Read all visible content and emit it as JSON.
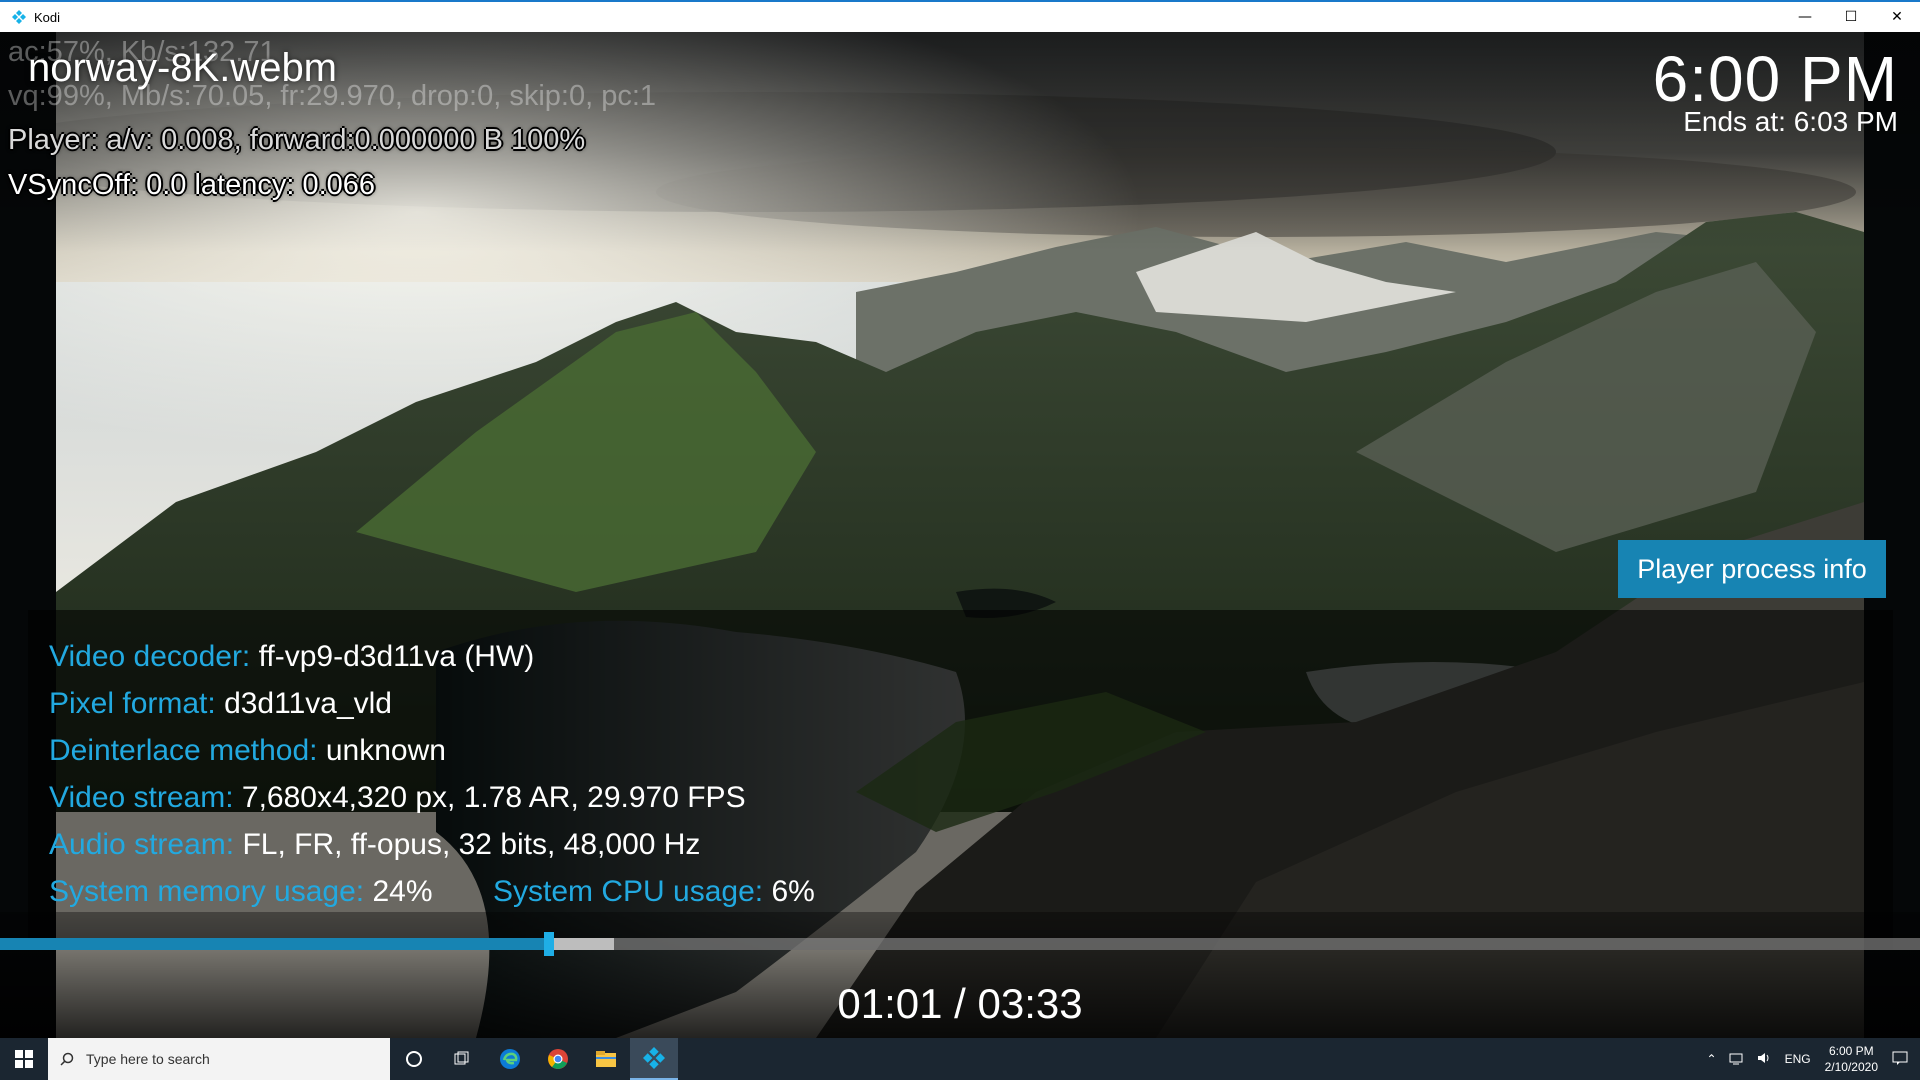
{
  "window": {
    "title": "Kodi",
    "minimize": "—",
    "maximize": "☐",
    "close": "✕"
  },
  "player": {
    "filename": "norway-8K.webm",
    "clock": "6:00 PM",
    "ends_at": "Ends at: 6:03 PM",
    "debug": {
      "line_ac": "ac:57%, Kb/s:132.71",
      "line_vq": "vq:99%, Mb/s:70.05, fr:29.970, drop:0, skip:0, pc:1",
      "line_player": "Player: a/v: 0.008,  forward:0.000000 B 100%",
      "line_vsync": "VSyncOff: 0.0 latency: 0.066"
    },
    "process_info_button": "Player process info",
    "info": {
      "video_decoder_label": "Video decoder:",
      "video_decoder_value": "ff-vp9-d3d11va (HW)",
      "pixel_format_label": "Pixel format:",
      "pixel_format_value": "d3d11va_vld",
      "deinterlace_label": "Deinterlace method:",
      "deinterlace_value": "unknown",
      "video_stream_label": "Video stream:",
      "video_stream_value": "7,680x4,320 px, 1.78 AR, 29.970 FPS",
      "audio_stream_label": "Audio stream:",
      "audio_stream_value": "FL, FR, ff-opus, 32 bits, 48,000 Hz",
      "memory_label": "System memory usage:",
      "memory_value": "24%",
      "cpu_label": "System CPU usage:",
      "cpu_value": "6%"
    },
    "progress": {
      "played_fraction": 0.286,
      "cached_fraction": 0.32
    },
    "time_display": "01:01 / 03:33",
    "colors": {
      "accent": "#1784b3",
      "label_blue": "#22a9e0"
    }
  },
  "taskbar": {
    "search_placeholder": "Type here to search",
    "language": "ENG",
    "time": "6:00 PM",
    "date": "2/10/2020",
    "pinned_icons": [
      "cortana-icon",
      "task-view-icon",
      "edge-icon",
      "chrome-icon",
      "file-explorer-icon",
      "kodi-icon"
    ]
  }
}
